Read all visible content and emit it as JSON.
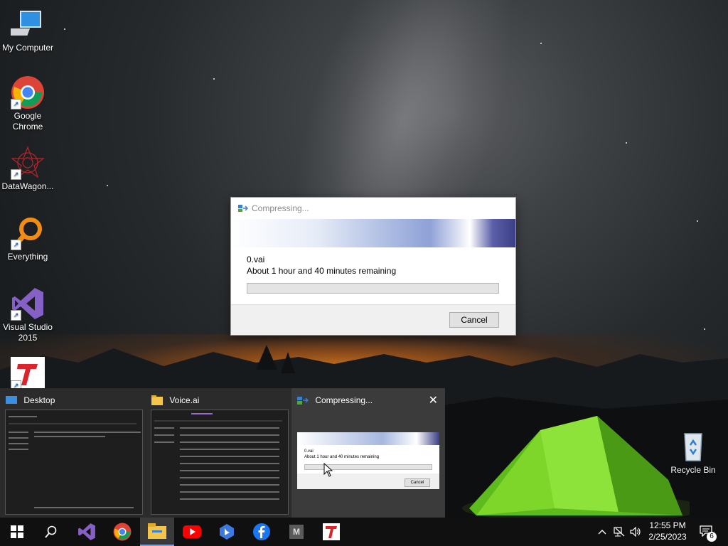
{
  "desktop_icons": [
    {
      "label": "My Computer",
      "icon": "computer-icon"
    },
    {
      "label": "Google Chrome",
      "icon": "chrome-icon"
    },
    {
      "label": "DataWagon...",
      "icon": "datawagon-icon"
    },
    {
      "label": "Everything",
      "icon": "everything-search-icon"
    },
    {
      "label": "Visual Studio 2015",
      "icon": "visual-studio-icon"
    },
    {
      "label": "",
      "icon": "red-t-app-icon"
    }
  ],
  "recycle_bin": {
    "label": "Recycle Bin"
  },
  "dialog": {
    "title": "Compressing...",
    "filename": "0.vai",
    "remaining": "About 1 hour and 40 minutes remaining",
    "progress": 0,
    "cancel_label": "Cancel"
  },
  "task_switcher": {
    "cards": [
      {
        "title": "Desktop"
      },
      {
        "title": "Voice.ai"
      },
      {
        "title": "Compressing..."
      }
    ],
    "mini_dialog": {
      "filename": "0.vai",
      "remaining": "About 1 hour and 40 minutes remaining",
      "cancel_label": "Cancel"
    }
  },
  "taskbar": {
    "apps": [
      "start-icon",
      "search-icon",
      "visual-studio-icon",
      "chrome-icon",
      "file-explorer-icon",
      "youtube-icon",
      "bing-icon",
      "facebook-icon",
      "m-app-icon",
      "red-t-app-icon"
    ],
    "time": "12:55 PM",
    "date": "2/25/2023",
    "notification_count": "6"
  },
  "colors": {
    "progress_fill": "#4cbb4c",
    "switcher_bg": "#2b2b2b",
    "taskbar_bg": "#101010"
  }
}
